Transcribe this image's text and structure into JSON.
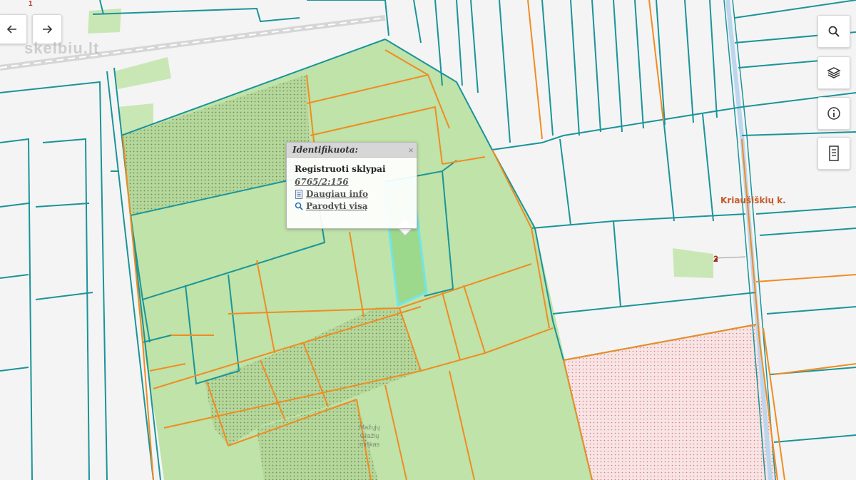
{
  "nav": {
    "back_icon": "arrow-left-icon",
    "forward_icon": "arrow-right-icon"
  },
  "watermark": "skelbiu.lt",
  "toolbar": [
    {
      "name": "search",
      "icon": "search-icon"
    },
    {
      "name": "layers",
      "icon": "layers-icon"
    },
    {
      "name": "info",
      "icon": "info-icon"
    },
    {
      "name": "document",
      "icon": "document-icon"
    }
  ],
  "popup": {
    "title": "Identifikuota:",
    "close_glyph": "×",
    "layer_name": "Registruoti sklypai",
    "parcel_id": "6765/2:156",
    "more_info": "Daugiau info",
    "show_all": "Parodyti visą"
  },
  "labels": {
    "village": "Kriaušiškių k.",
    "forest": [
      "Mažųjų",
      "Gražių",
      "miškas"
    ],
    "sheet_number": "1",
    "point_number": "2"
  },
  "colors": {
    "background": "#f4f4f4",
    "parcel_fill": "#bfe3a8",
    "parcel_line": "#1a9499",
    "cadastre_line": "#f08c22",
    "restricted_fill": "#f6e2e2",
    "highlight": "#6fe6ec",
    "water": "#bcd6ee"
  }
}
